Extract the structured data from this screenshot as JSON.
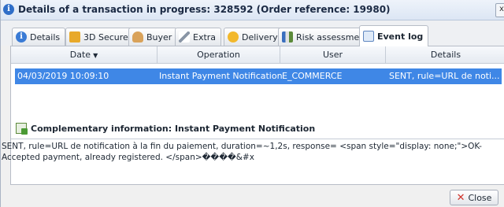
{
  "window": {
    "title": "Details of a transaction in progress: 328592 (Order reference: 19980)",
    "close_glyph": "x"
  },
  "tabs": [
    {
      "label": "Details",
      "icon": "info-icon"
    },
    {
      "label": "3D Secure",
      "icon": "3ds-icon"
    },
    {
      "label": "Buyer",
      "icon": "buyer-icon"
    },
    {
      "label": "Extra",
      "icon": "pencil-icon"
    },
    {
      "label": "Delivery",
      "icon": "delivery-icon"
    },
    {
      "label": "Risk assessment",
      "icon": "chart-icon"
    },
    {
      "label": "Event log",
      "icon": "log-icon",
      "active": true
    }
  ],
  "grid": {
    "columns": [
      "Date",
      "Operation",
      "User",
      "Details"
    ],
    "sort_column": "Date",
    "rows": [
      {
        "date": "04/03/2019 10:09:10",
        "operation": "Instant Payment Notification",
        "user": "E_COMMERCE",
        "details": "SENT, rule=URL de noti..."
      }
    ],
    "selected_row_color": "#3f87e6"
  },
  "complementary": {
    "title": "Complementary information: Instant Payment Notification",
    "text": "SENT, rule=URL de notification à la fin du paiement, duration=~1,2s, response= <span style=\"display: none;\">OK-Accepted payment, already registered. </span>����&#x"
  },
  "footer": {
    "close_label": "Close"
  }
}
